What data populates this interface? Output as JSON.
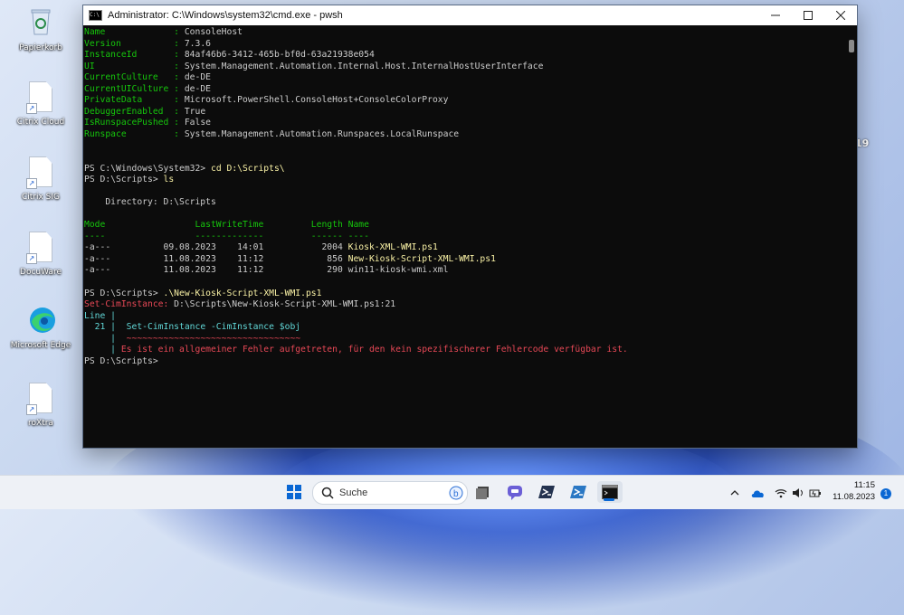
{
  "window": {
    "title": "Administrator: C:\\Windows\\system32\\cmd.exe - pwsh",
    "icon_name": "cmd-icon",
    "controls": [
      "minimize-icon",
      "maximize-icon",
      "close-icon"
    ]
  },
  "console": {
    "host_props": [
      {
        "key": "Name            ",
        "val": "ConsoleHost"
      },
      {
        "key": "Version         ",
        "val": "7.3.6"
      },
      {
        "key": "InstanceId      ",
        "val": "84af46b6-3412-465b-bf0d-63a21938e054"
      },
      {
        "key": "UI              ",
        "val": "System.Management.Automation.Internal.Host.InternalHostUserInterface"
      },
      {
        "key": "CurrentCulture  ",
        "val": "de-DE"
      },
      {
        "key": "CurrentUICulture",
        "val": "de-DE"
      },
      {
        "key": "PrivateData     ",
        "val": "Microsoft.PowerShell.ConsoleHost+ConsoleColorProxy"
      },
      {
        "key": "DebuggerEnabled ",
        "val": "True"
      },
      {
        "key": "IsRunspacePushed",
        "val": "False"
      },
      {
        "key": "Runspace        ",
        "val": "System.Management.Automation.Runspaces.LocalRunspace"
      }
    ],
    "prompt1": "PS C:\\Windows\\System32> ",
    "cmd1": "cd D:\\Scripts\\",
    "prompt2": "PS D:\\Scripts> ",
    "cmd2": "ls",
    "directory_line": "    Directory: D:\\Scripts",
    "table_header": "Mode                 LastWriteTime         Length Name",
    "table_rule": "----                 -------------         ------ ----",
    "files": [
      {
        "prefix": "-a---          09.08.2023    14:01           2004 ",
        "name": "Kiosk-XML-WMI.ps1",
        "script": true
      },
      {
        "prefix": "-a---          11.08.2023    11:12            856 ",
        "name": "New-Kiosk-Script-XML-WMI.ps1",
        "script": true
      },
      {
        "prefix": "-a---          11.08.2023    11:12            290 ",
        "name": "win11-kiosk-wmi.xml",
        "script": false
      }
    ],
    "prompt3": "PS D:\\Scripts> ",
    "cmd3": ".\\New-Kiosk-Script-XML-WMI.ps1",
    "err_label": "Set-CimInstance: ",
    "err_location": "D:\\Scripts\\New-Kiosk-Script-XML-WMI.ps1:21",
    "err_line_word": "Line |",
    "err_line_no": "  21 | ",
    "err_code": " Set-CimInstance -CimInstance $obj",
    "err_pipe_a": "     | ",
    "err_tilde": " ~~~~~~~~~~~~~~~~~~~~~~~~~~~~~~~~~",
    "err_pipe_b": "     | ",
    "err_message": "Es ist ein allgemeiner Fehler aufgetreten, für den kein spezifischerer Fehlercode verfügbar ist.",
    "prompt4": "PS D:\\Scripts>"
  },
  "desktop": {
    "icons": [
      {
        "label": "Papierkorb",
        "icon": "recycle-bin-icon"
      },
      {
        "label": "Citrix Cloud",
        "icon": "file-shortcut-icon"
      },
      {
        "label": "Citrix SIG",
        "icon": "file-shortcut-icon"
      },
      {
        "label": "DocuWare",
        "icon": "file-shortcut-icon"
      },
      {
        "label": "Microsoft Edge",
        "icon": "edge-icon"
      },
      {
        "label": "roXtra",
        "icon": "file-shortcut-icon"
      }
    ],
    "stray_text": "19"
  },
  "taskbar": {
    "search_placeholder": "Suche",
    "time": "11:15",
    "date": "11.08.2023",
    "notification_count": "1",
    "colors": {
      "accent": "#0a67d3",
      "terminal_bg": "#0c0c0c",
      "ps_green": "#16c60c",
      "ps_error": "#e74856"
    }
  }
}
